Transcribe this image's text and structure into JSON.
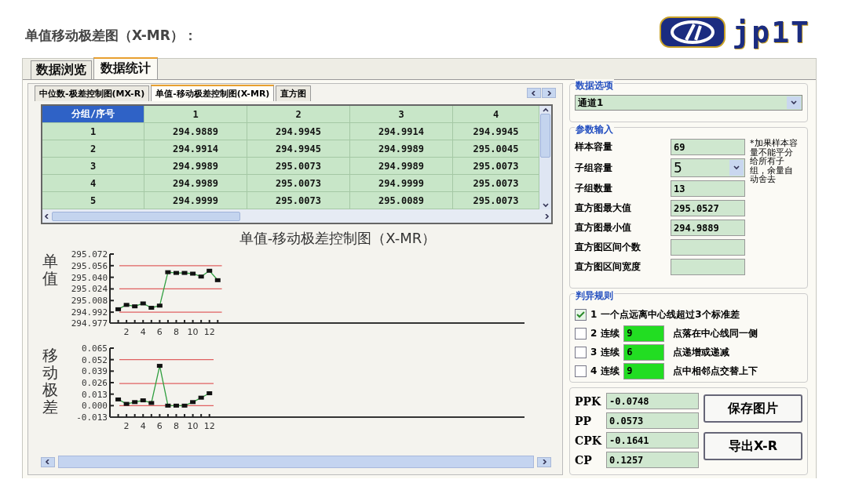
{
  "article_heading": "单值移动极差图（X-MR）：",
  "logo": {
    "text": "jp1T"
  },
  "main_tabs": [
    {
      "label": "数据浏览",
      "selected": false
    },
    {
      "label": "数据统计",
      "selected": true
    }
  ],
  "chart_tabs": [
    {
      "label": "中位数-极差控制图(MX-R)",
      "selected": false
    },
    {
      "label": "单值-移动极差控制图(X-MR)",
      "selected": true
    },
    {
      "label": "直方图",
      "selected": false
    }
  ],
  "table": {
    "columns": [
      "分组/序号",
      "1",
      "2",
      "3",
      "4"
    ],
    "rows": [
      [
        "1",
        "294.9889",
        "294.9945",
        "294.9914",
        "294.9945"
      ],
      [
        "2",
        "294.9914",
        "294.9945",
        "294.9989",
        "295.0045"
      ],
      [
        "3",
        "294.9989",
        "295.0073",
        "294.9989",
        "295.0073"
      ],
      [
        "4",
        "294.9989",
        "295.0073",
        "294.9999",
        "295.0073"
      ],
      [
        "5",
        "294.9999",
        "295.0073",
        "295.0089",
        "295.0073"
      ]
    ]
  },
  "chart_title": "单值-移动极差控制图（X-MR）",
  "charts": [
    {
      "chart_data": {
        "type": "line",
        "ylabel": "单值",
        "x": [
          1,
          2,
          3,
          4,
          5,
          6,
          7,
          8,
          9,
          10,
          11,
          12,
          13
        ],
        "series": [
          {
            "color": "#2e9e3e",
            "marker": "square",
            "values": [
              294.996,
              295.002,
              295.0,
              295.004,
              294.998,
              295.001,
              295.047,
              295.046,
              295.046,
              295.045,
              295.041,
              295.049,
              295.036
            ]
          }
        ],
        "xlim": [
          0,
          50
        ],
        "ylim": [
          294.977,
          295.072
        ],
        "xticks": [
          2,
          4,
          6,
          8,
          10,
          12
        ],
        "yticks": [
          {
            "value": 294.977,
            "label": "294.977"
          },
          {
            "value": 294.992,
            "label": "294.992"
          },
          {
            "value": 295.008,
            "label": "295.008"
          },
          {
            "value": 295.024,
            "label": "295.024"
          },
          {
            "value": 295.04,
            "label": "295.040"
          },
          {
            "value": 295.056,
            "label": "295.056"
          },
          {
            "value": 295.072,
            "label": "295.072"
          }
        ],
        "ref_lines": [
          {
            "axis": "y",
            "value": 295.056,
            "color": "#e06060"
          },
          {
            "axis": "y",
            "value": 295.024,
            "color": "#e06060"
          },
          {
            "axis": "y",
            "value": 294.992,
            "color": "#e06060"
          }
        ]
      }
    },
    {
      "chart_data": {
        "type": "line",
        "ylabel": "移动极差",
        "x": [
          1,
          2,
          3,
          4,
          5,
          6,
          7,
          8,
          9,
          10,
          11,
          12
        ],
        "series": [
          {
            "color": "#2e9e3e",
            "marker": "square",
            "values": [
              0.007,
              0.002,
              0.004,
              0.006,
              0.003,
              0.045,
              0.0,
              0.0,
              0.0,
              0.004,
              0.009,
              0.014
            ]
          }
        ],
        "xlim": [
          0,
          50
        ],
        "ylim": [
          -0.013,
          0.065
        ],
        "xticks": [
          2,
          4,
          6,
          8,
          10,
          12
        ],
        "yticks": [
          {
            "value": -0.013,
            "label": "-0.013"
          },
          {
            "value": 0,
            "label": "0.000"
          },
          {
            "value": 0.013,
            "label": "0.013"
          },
          {
            "value": 0.026,
            "label": "0.026"
          },
          {
            "value": 0.039,
            "label": "0.039"
          },
          {
            "value": 0.052,
            "label": "0.052"
          },
          {
            "value": 0.065,
            "label": "0.065"
          }
        ],
        "ref_lines": [
          {
            "axis": "y",
            "value": 0.052,
            "color": "#e06060"
          },
          {
            "axis": "y",
            "value": 0.025,
            "color": "#e06060"
          },
          {
            "axis": "y",
            "value": 0.0,
            "color": "#e06060"
          }
        ]
      }
    }
  ],
  "data_options": {
    "title": "数据选项",
    "channel": "通道1"
  },
  "parameters": {
    "title": "参数输入",
    "note": "*加果样本容量不能平分给所有子组，余量自动舍去",
    "fields": [
      {
        "label": "样本容量",
        "value": "69",
        "kind": "text"
      },
      {
        "label": "子组容量",
        "value": "5",
        "kind": "select"
      },
      {
        "label": "子组数量",
        "value": "13",
        "kind": "text"
      },
      {
        "label": "直方图最大值",
        "value": "295.0527",
        "kind": "text"
      },
      {
        "label": "直方图最小值",
        "value": "294.9889",
        "kind": "text"
      },
      {
        "label": "直方图区间个数",
        "kind": "text"
      },
      {
        "label": "直方图区间宽度",
        "kind": "text"
      }
    ]
  },
  "rules": {
    "title": "判异规则",
    "items": [
      {
        "kind": "plain",
        "number": "1",
        "checked": true,
        "text": "一个点远离中心线超过3个标准差"
      },
      {
        "kind": "count",
        "number": "2",
        "checked": false,
        "prefix": "连续",
        "count": "9",
        "text": "点落在中心线同一侧"
      },
      {
        "kind": "count",
        "number": "3",
        "checked": false,
        "prefix": "连续",
        "count": "6",
        "text": "点递增或递减"
      },
      {
        "kind": "count",
        "number": "4",
        "checked": false,
        "prefix": "连续",
        "count": "9",
        "text": "点中相邻点交替上下"
      }
    ]
  },
  "indices": [
    {
      "label": "PPK",
      "value": "-0.0748"
    },
    {
      "label": "PP",
      "value": "0.0573"
    },
    {
      "label": "CPK",
      "value": "-0.1641"
    },
    {
      "label": "CP",
      "value": "0.1257"
    }
  ],
  "buttons": [
    "保存图片",
    "导出X-R"
  ]
}
